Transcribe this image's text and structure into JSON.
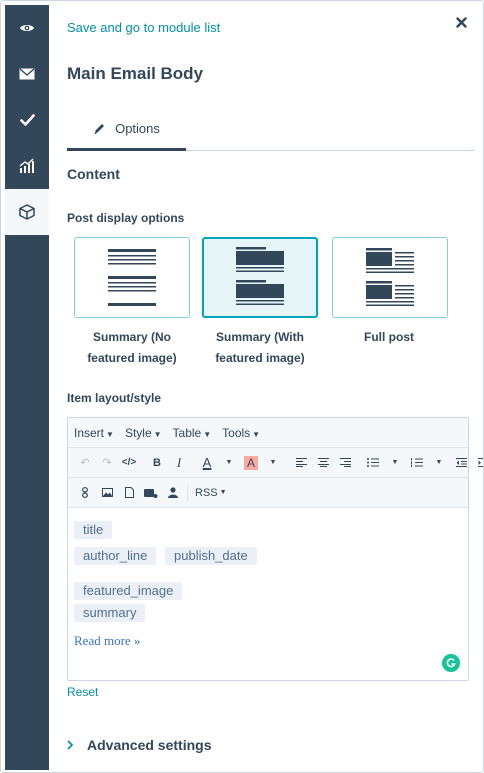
{
  "nav": {
    "items": [
      {
        "icon": "eye-icon",
        "active": false
      },
      {
        "icon": "envelope-icon",
        "active": false
      },
      {
        "icon": "checkmark-icon",
        "active": false
      },
      {
        "icon": "analytics-icon",
        "active": false
      },
      {
        "icon": "module-box-icon",
        "active": true
      }
    ]
  },
  "header": {
    "back_link": "Save and go to module list",
    "title": "Main Email Body",
    "close_icon": "close-icon"
  },
  "tabs": [
    {
      "label": "Options",
      "icon": "pencil-icon",
      "active": true
    }
  ],
  "content": {
    "section_title": "Content",
    "post_display": {
      "label": "Post display options",
      "options": [
        {
          "label_line1": "Summary (No",
          "label_line2": "featured image)",
          "selected": false
        },
        {
          "label_line1": "Summary (With",
          "label_line2": "featured image)",
          "selected": true
        },
        {
          "label_line1": "Full post",
          "label_line2": "",
          "selected": false
        }
      ]
    },
    "item_layout": {
      "label": "Item layout/style",
      "menus": [
        "Insert",
        "Style",
        "Table",
        "Tools"
      ],
      "font_select": "RSS",
      "tokens": [
        "title",
        "author_line",
        "publish_date",
        "featured_image",
        "summary"
      ],
      "read_more": "Read more »"
    },
    "reset_label": "Reset",
    "advanced_label": "Advanced settings"
  },
  "colors": {
    "rail": "#33475b",
    "accent": "#00a4bd",
    "link": "#0091ae",
    "token_bg": "#eaf0f6"
  }
}
